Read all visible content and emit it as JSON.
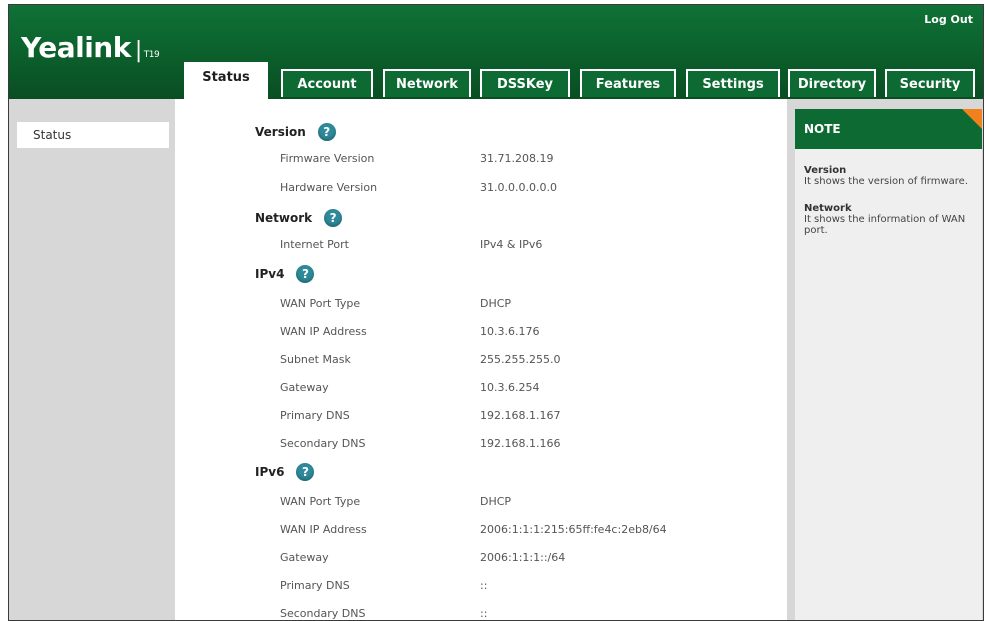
{
  "header": {
    "brand": "Yealink",
    "separator": "|",
    "model": "T19",
    "logout_label": "Log Out",
    "tabs": [
      {
        "label": "Status",
        "active": true
      },
      {
        "label": "Account"
      },
      {
        "label": "Network"
      },
      {
        "label": "DSSKey"
      },
      {
        "label": "Features"
      },
      {
        "label": "Settings"
      },
      {
        "label": "Directory"
      },
      {
        "label": "Security"
      }
    ]
  },
  "sidebar": {
    "items": [
      {
        "label": "Status"
      }
    ]
  },
  "main": {
    "help_glyph": "?",
    "version": {
      "title": "Version",
      "rows": [
        {
          "label": "Firmware Version",
          "value": "31.71.208.19"
        },
        {
          "label": "Hardware Version",
          "value": "31.0.0.0.0.0.0"
        }
      ]
    },
    "network": {
      "title": "Network",
      "rows": [
        {
          "label": "Internet Port",
          "value": "IPv4 & IPv6"
        }
      ]
    },
    "ipv4": {
      "title": "IPv4",
      "rows": [
        {
          "label": "WAN Port Type",
          "value": "DHCP"
        },
        {
          "label": "WAN IP Address",
          "value": "10.3.6.176"
        },
        {
          "label": "Subnet Mask",
          "value": "255.255.255.0"
        },
        {
          "label": "Gateway",
          "value": "10.3.6.254"
        },
        {
          "label": "Primary DNS",
          "value": "192.168.1.167"
        },
        {
          "label": "Secondary DNS",
          "value": "192.168.1.166"
        }
      ]
    },
    "ipv6": {
      "title": "IPv6",
      "rows": [
        {
          "label": "WAN Port Type",
          "value": "DHCP"
        },
        {
          "label": "WAN IP Address",
          "value": "2006:1:1:1:215:65ff:fe4c:2eb8/64"
        },
        {
          "label": "Gateway",
          "value": "2006:1:1:1::/64"
        },
        {
          "label": "Primary DNS",
          "value": "::"
        },
        {
          "label": "Secondary DNS",
          "value": "::"
        }
      ]
    }
  },
  "note": {
    "title": "NOTE",
    "entries": [
      {
        "heading": "Version",
        "text": "It shows the version of firmware."
      },
      {
        "heading": "Network",
        "text": "It shows the information of WAN port."
      }
    ]
  },
  "colors": {
    "header_green": "#0e6a33",
    "note_corner_orange": "#f0821e",
    "panel_gray": "#d7d7d7",
    "help_icon_teal": "#2e8a9a"
  }
}
